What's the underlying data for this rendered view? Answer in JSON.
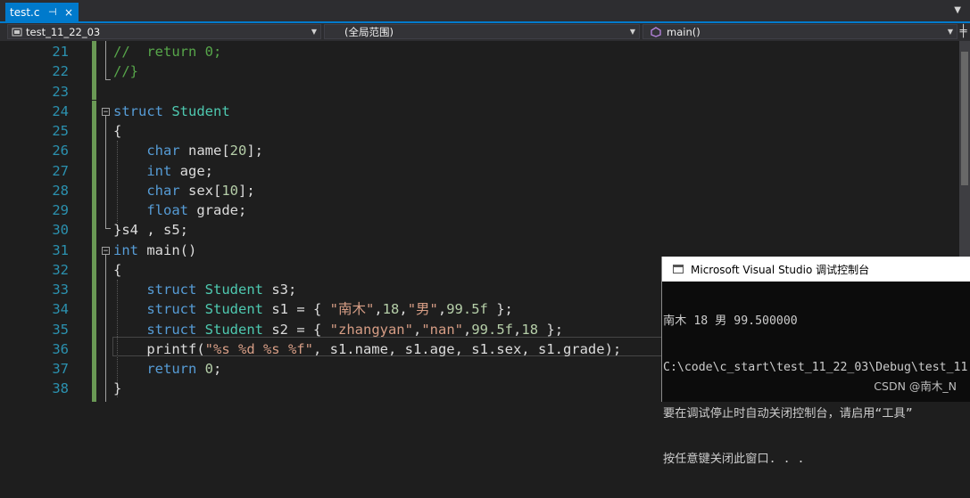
{
  "tab": {
    "label": "test.c",
    "pin": "⊣",
    "close": "×"
  },
  "nav": {
    "project": "test_11_22_03",
    "scope": "(全局范围)",
    "member": "main()"
  },
  "lines": [
    {
      "no": "21",
      "code": [
        {
          "t": "//  return 0;",
          "c": "cm"
        }
      ]
    },
    {
      "no": "22",
      "code": [
        {
          "t": "//}",
          "c": "cm"
        }
      ]
    },
    {
      "no": "23",
      "code": []
    },
    {
      "no": "24",
      "code": [
        {
          "t": "struct",
          "c": "kw"
        },
        {
          "t": " "
        },
        {
          "t": "Student",
          "c": "ty"
        }
      ]
    },
    {
      "no": "25",
      "code": [
        {
          "t": "{"
        }
      ]
    },
    {
      "no": "26",
      "code": [
        {
          "t": "    "
        },
        {
          "t": "char",
          "c": "kw"
        },
        {
          "t": " name["
        },
        {
          "t": "20",
          "c": "num"
        },
        {
          "t": "];"
        }
      ]
    },
    {
      "no": "27",
      "code": [
        {
          "t": "    "
        },
        {
          "t": "int",
          "c": "kw"
        },
        {
          "t": " age;"
        }
      ]
    },
    {
      "no": "28",
      "code": [
        {
          "t": "    "
        },
        {
          "t": "char",
          "c": "kw"
        },
        {
          "t": " sex["
        },
        {
          "t": "10",
          "c": "num"
        },
        {
          "t": "];"
        }
      ]
    },
    {
      "no": "29",
      "code": [
        {
          "t": "    "
        },
        {
          "t": "float",
          "c": "kw"
        },
        {
          "t": " grade;"
        }
      ]
    },
    {
      "no": "30",
      "code": [
        {
          "t": "}s4 , s5;"
        }
      ]
    },
    {
      "no": "31",
      "code": [
        {
          "t": "int",
          "c": "kw"
        },
        {
          "t": " main()"
        }
      ]
    },
    {
      "no": "32",
      "code": [
        {
          "t": "{"
        }
      ]
    },
    {
      "no": "33",
      "code": [
        {
          "t": "    "
        },
        {
          "t": "struct",
          "c": "kw"
        },
        {
          "t": " "
        },
        {
          "t": "Student",
          "c": "ty"
        },
        {
          "t": " s3;"
        }
      ]
    },
    {
      "no": "34",
      "code": [
        {
          "t": "    "
        },
        {
          "t": "struct",
          "c": "kw"
        },
        {
          "t": " "
        },
        {
          "t": "Student",
          "c": "ty"
        },
        {
          "t": " s1 = { "
        },
        {
          "t": "\"南木\"",
          "c": "str"
        },
        {
          "t": ","
        },
        {
          "t": "18",
          "c": "num"
        },
        {
          "t": ","
        },
        {
          "t": "\"男\"",
          "c": "str"
        },
        {
          "t": ","
        },
        {
          "t": "99.5f",
          "c": "num"
        },
        {
          "t": " };"
        }
      ]
    },
    {
      "no": "35",
      "code": [
        {
          "t": "    "
        },
        {
          "t": "struct",
          "c": "kw"
        },
        {
          "t": " "
        },
        {
          "t": "Student",
          "c": "ty"
        },
        {
          "t": " s2 = { "
        },
        {
          "t": "\"zhangyan\"",
          "c": "str"
        },
        {
          "t": ","
        },
        {
          "t": "\"nan\"",
          "c": "str"
        },
        {
          "t": ","
        },
        {
          "t": "99.5f",
          "c": "num"
        },
        {
          "t": ","
        },
        {
          "t": "18",
          "c": "num"
        },
        {
          "t": " };"
        }
      ]
    },
    {
      "no": "36",
      "code": [
        {
          "t": "    printf("
        },
        {
          "t": "\"%s %d %s %f\"",
          "c": "str"
        },
        {
          "t": ", s1.name, s1.age, s1.sex, s1.grade);"
        }
      ]
    },
    {
      "no": "37",
      "code": [
        {
          "t": "    "
        },
        {
          "t": "return",
          "c": "kw"
        },
        {
          "t": " "
        },
        {
          "t": "0",
          "c": "num"
        },
        {
          "t": ";"
        }
      ]
    },
    {
      "no": "38",
      "code": [
        {
          "t": "}"
        }
      ]
    }
  ],
  "console": {
    "title": "Microsoft Visual Studio 调试控制台",
    "lines": [
      "南木 18 男 99.500000",
      "C:\\code\\c_start\\test_11_22_03\\Debug\\test_11",
      "要在调试停止时自动关闭控制台，请启用“工具”",
      "按任意键关闭此窗口. . ."
    ]
  },
  "watermark": "CSDN @南木_N"
}
